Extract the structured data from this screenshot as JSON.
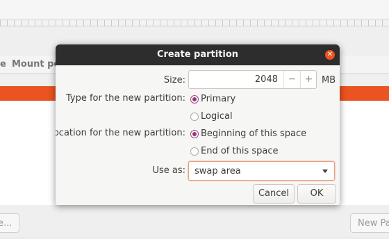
{
  "background": {
    "column_prefix": "e",
    "column_mount": "Mount poi",
    "left_button": "e...",
    "right_button": "New Pa",
    "bottom_text": "..."
  },
  "dialog": {
    "title": "Create partition",
    "close_icon": "close-icon",
    "size_label": "Size:",
    "size_value": "2048",
    "size_minus": "−",
    "size_plus": "+",
    "size_unit": "MB",
    "type_label": "Type for the new partition:",
    "type_options": [
      "Primary",
      "Logical"
    ],
    "type_selected": "Primary",
    "location_label": "Location for the new partition:",
    "location_options": [
      "Beginning of this space",
      "End of this space"
    ],
    "location_selected": "Beginning of this space",
    "use_as_label": "Use as:",
    "use_as_value": "swap area",
    "cancel_label": "Cancel",
    "ok_label": "OK"
  },
  "colors": {
    "accent": "#e95420",
    "titlebar": "#2d2d2d",
    "radio_checked": "#92387a"
  }
}
